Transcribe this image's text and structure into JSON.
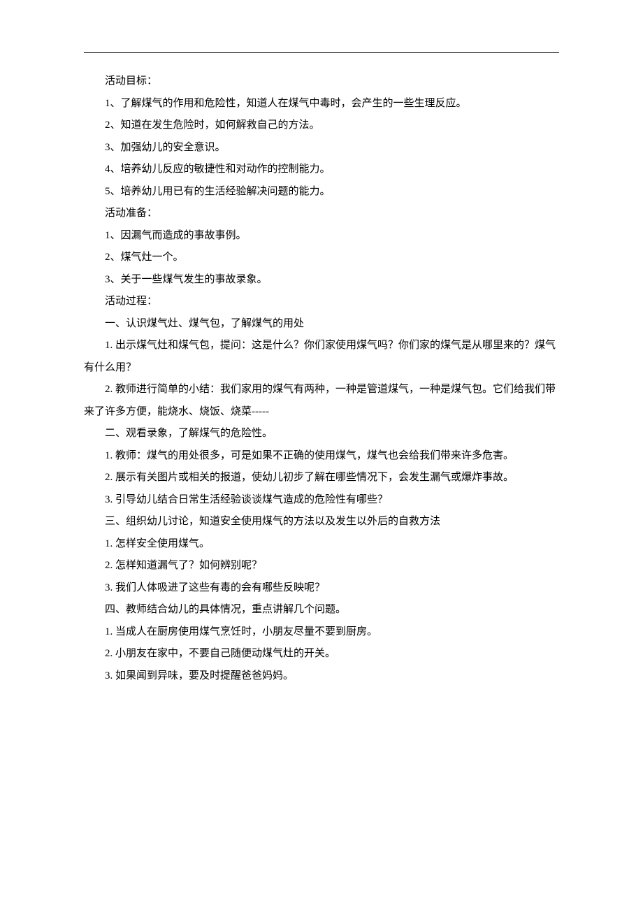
{
  "lines": [
    "活动目标：",
    "1、了解煤气的作用和危险性，知道人在煤气中毒时，会产生的一些生理反应。",
    "2、知道在发生危险时，如何解救自己的方法。",
    "3、加强幼儿的安全意识。",
    "4、培养幼儿反应的敏捷性和对动作的控制能力。",
    "5、培养幼儿用已有的生活经验解决问题的能力。",
    "活动准备：",
    "1、因漏气而造成的事故事例。",
    "2、煤气灶一个。",
    "3、关于一些煤气发生的事故录象。",
    "活动过程：",
    "一、认识煤气灶、煤气包，了解煤气的用处",
    "1. 出示煤气灶和煤气包，提问：这是什么？你们家使用煤气吗？你们家的煤气是从哪里来的？煤气有什么用？",
    "2. 教师进行简单的小结：我们家用的煤气有两种，一种是管道煤气，一种是煤气包。它们给我们带来了许多方便，能烧水、烧饭、烧菜-----",
    "二、观看录象，了解煤气的危险性。",
    "1. 教师：煤气的用处很多，可是如果不正确的使用煤气，煤气也会给我们带来许多危害。",
    "2. 展示有关图片或相关的报道，使幼儿初步了解在哪些情况下，会发生漏气或爆炸事故。",
    "3. 引导幼儿结合日常生活经验谈谈煤气造成的危险性有哪些？",
    "三、组织幼儿讨论，知道安全使用煤气的方法以及发生以外后的自救方法",
    "1. 怎样安全使用煤气。",
    "2. 怎样知道漏气了？如何辨别呢？",
    "3. 我们人体吸进了这些有毒的会有哪些反映呢？",
    "四、教师结合幼儿的具体情况，重点讲解几个问题。",
    "1. 当成人在厨房使用煤气烹饪时，小朋友尽量不要到厨房。",
    "2. 小朋友在家中，不要自己随便动煤气灶的开关。",
    "3. 如果闻到异味，要及时提醒爸爸妈妈。"
  ],
  "wrap_indices": [
    12,
    13,
    15,
    16
  ]
}
